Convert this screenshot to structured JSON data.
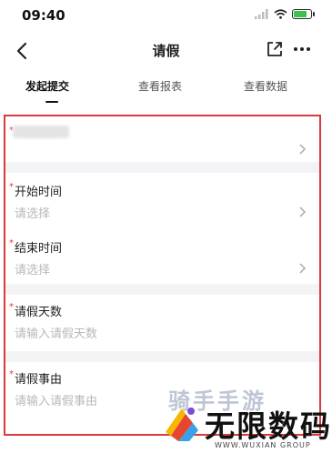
{
  "status_bar": {
    "time": "09:40"
  },
  "nav": {
    "title": "请假"
  },
  "tabs": [
    {
      "label": "发起提交",
      "active": true
    },
    {
      "label": "查看报表",
      "active": false
    },
    {
      "label": "查看数据",
      "active": false
    }
  ],
  "form": {
    "fields": [
      {
        "label": "开始时间",
        "placeholder": "请选择"
      },
      {
        "label": "结束时间",
        "placeholder": "请选择"
      },
      {
        "label": "请假天数",
        "placeholder": "请输入请假天数"
      },
      {
        "label": "请假事由",
        "placeholder": "请输入请假事由"
      }
    ]
  },
  "watermark": {
    "top_text": "骑手手游",
    "brand": "无限数码",
    "sub": "WWW.WUXIAN GROUP"
  },
  "colors": {
    "highlight_border": "#d93a3a",
    "battery": "#3cc24a",
    "placeholder": "#b8b8b8"
  }
}
